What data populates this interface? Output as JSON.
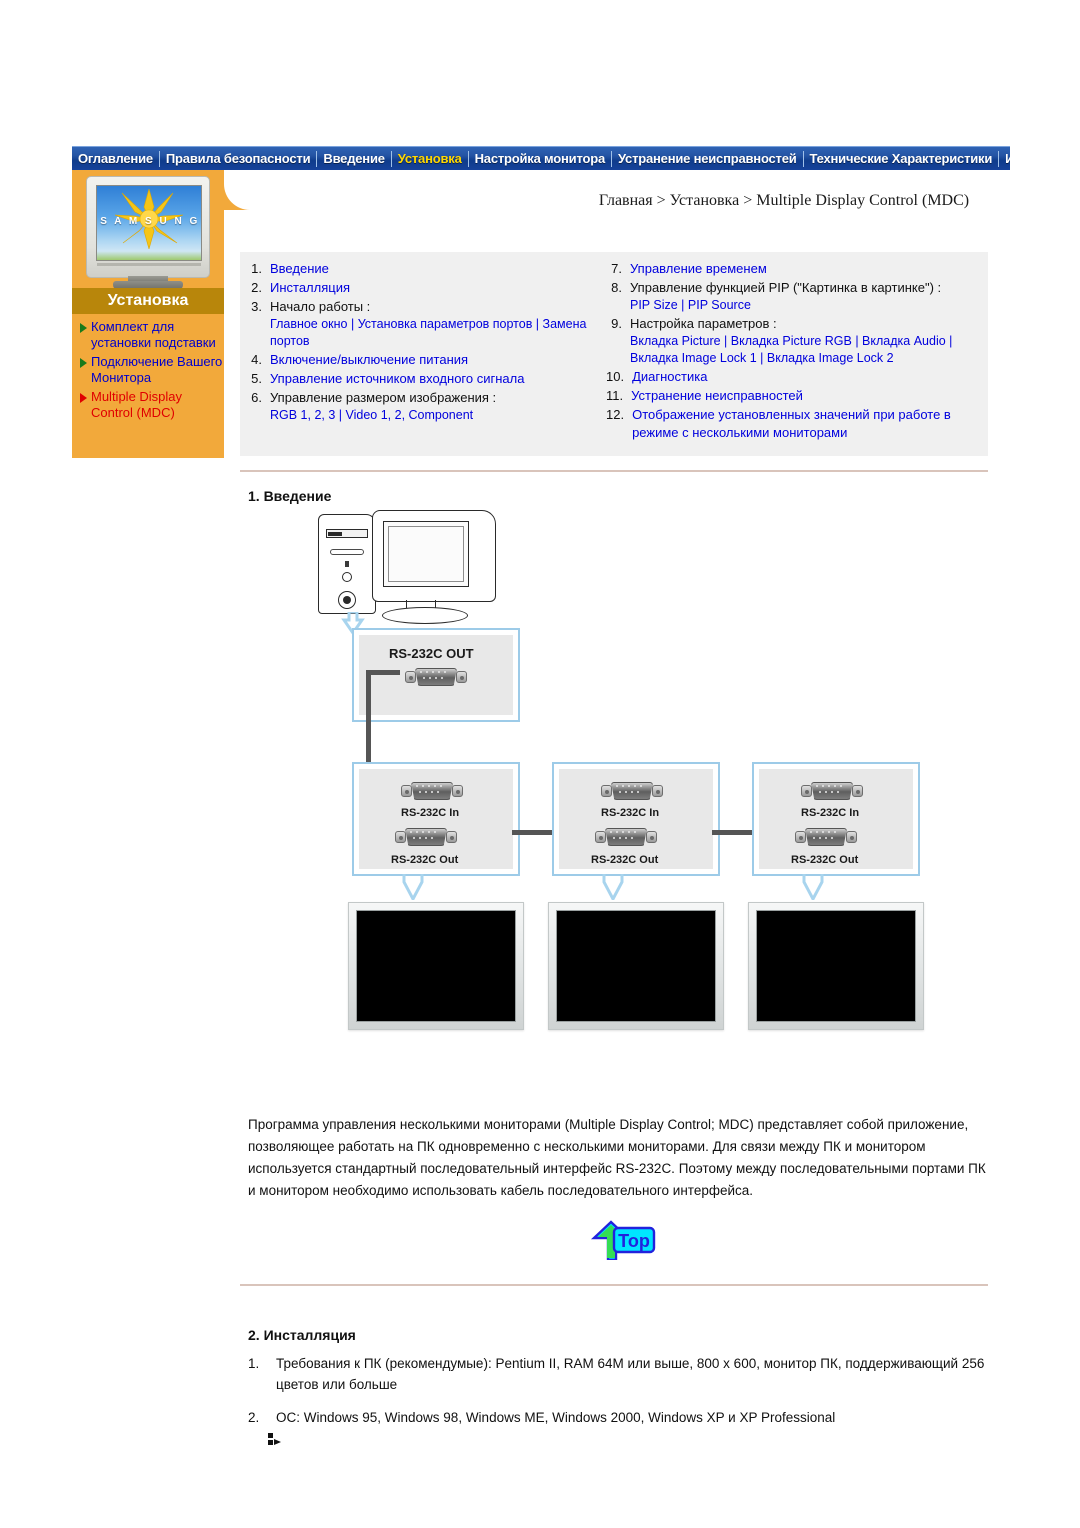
{
  "topnav": {
    "items": [
      {
        "label": "Оглавление",
        "active": false
      },
      {
        "label": "Правила безопасности",
        "active": false
      },
      {
        "label": "Введение",
        "active": false
      },
      {
        "label": "Установка",
        "active": true
      },
      {
        "label": "Настройка монитора",
        "active": false
      },
      {
        "label": "Устранение неисправностей",
        "active": false
      },
      {
        "label": "Технические Характеристики",
        "active": false
      },
      {
        "label": "Информаци",
        "active": false
      }
    ],
    "active_color": "#ffd700",
    "bar_color": "#1f4fa0"
  },
  "sidebar": {
    "brand": "S A M S U N G",
    "section_title": "Установка",
    "accent_color": "#f2a93b",
    "title_bar_color": "#b8860b",
    "items": [
      {
        "label": "Комплект для установки подставки",
        "current": false
      },
      {
        "label": "Подключение Вашего Монитора",
        "current": false
      },
      {
        "label": "Multiple Display Control (MDC)",
        "current": true
      }
    ]
  },
  "breadcrumb": "Главная > Установка > Multiple Display Control (MDC)",
  "toc": {
    "left": [
      {
        "num": "1.",
        "title": "Введение",
        "title_link": true,
        "sub": ""
      },
      {
        "num": "2.",
        "title": "Инсталляция",
        "title_link": true,
        "sub": ""
      },
      {
        "num": "3.",
        "title": "Начало работы :",
        "title_link": false,
        "sub": "Главное окно | Установка параметров портов | Замена портов"
      },
      {
        "num": "4.",
        "title": "Включение/выключение питания",
        "title_link": true,
        "sub": ""
      },
      {
        "num": "5.",
        "title": "Управление источником входного сигнала",
        "title_link": true,
        "sub": ""
      },
      {
        "num": "6.",
        "title": "Управление размером изображения :",
        "title_link": false,
        "sub": "RGB 1, 2, 3 | Video 1, 2, Component"
      }
    ],
    "right": [
      {
        "num": "7.",
        "title": "Управление временем",
        "title_link": true,
        "sub": ""
      },
      {
        "num": "8.",
        "title": "Управление функцией PIP (\"Картинка в картинке\") :",
        "title_link": false,
        "sub": "PIP Size | PIP Source"
      },
      {
        "num": "9.",
        "title": "Настройка параметров :",
        "title_link": false,
        "sub": "Вкладка Picture | Вкладка Picture RGB | Вкладка Audio | Вкладка Image Lock 1 | Вкладка Image Lock 2"
      },
      {
        "num": "10.",
        "title": "Диагностика",
        "title_link": true,
        "sub": ""
      },
      {
        "num": "11.",
        "title": "Устранение неисправностей",
        "title_link": true,
        "sub": ""
      },
      {
        "num": "12.",
        "title": "Отображение установленных значений при работе в режиме с несколькими мониторами",
        "title_link": true,
        "sub": ""
      }
    ]
  },
  "section1": {
    "heading": "1. Введение",
    "paragraph": "Программа управления несколькими мониторами (Multiple Display Control; MDC) представляет собой приложение, позволяющее работать на ПК одновременно с несколькими мониторами. Для связи между ПК и монитором используется стандартный последовательный интерфейс RS-232C. Поэтому между последовательными портами ПК и монитором необходимо использовать кабель последовательного интерфейса."
  },
  "diagram": {
    "pc_out_label": "RS-232C OUT",
    "monitors": [
      {
        "in_label": "RS-232C In",
        "out_label": "RS-232C Out"
      },
      {
        "in_label": "RS-232C In",
        "out_label": "RS-232C Out"
      },
      {
        "in_label": "RS-232C In",
        "out_label": "RS-232C Out"
      }
    ]
  },
  "top_button": {
    "label": "Top"
  },
  "section2": {
    "heading": "2. Инсталляция",
    "items": [
      {
        "num": "1.",
        "text": "Требования к ПК (рекомендумые): Pentium II, RAM 64M или выше, 800 x 600, монитор ПК, поддерживающий 256 цветов или больше"
      },
      {
        "num": "2.",
        "text": "ОС: Windows 95, Windows 98, Windows ME, Windows 2000, Windows XP и XP Professional"
      }
    ]
  }
}
